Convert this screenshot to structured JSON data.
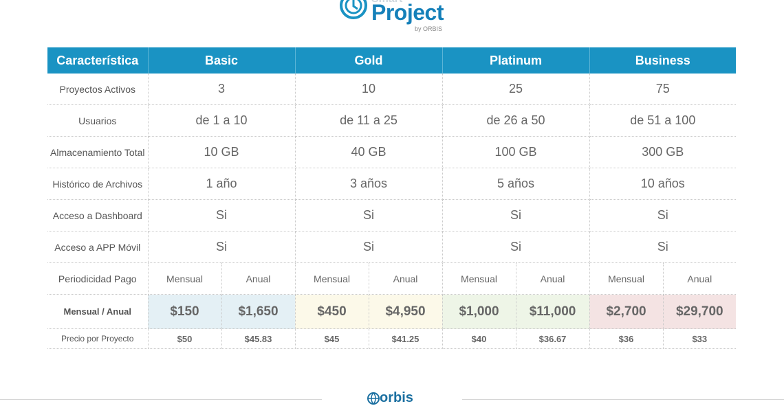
{
  "brand": {
    "line1": "Smart",
    "line2": "Project",
    "byline": "by ORBIS",
    "footer": "orbis",
    "accent": "#1a93c3"
  },
  "table": {
    "headers": [
      "Característica",
      "Basic",
      "Gold",
      "Platinum",
      "Business"
    ],
    "rows": [
      {
        "feature": "Proyectos Activos",
        "values": [
          "3",
          "10",
          "25",
          "75"
        ]
      },
      {
        "feature": "Usuarios",
        "values": [
          "de 1 a 10",
          "de 11 a 25",
          "de 26 a 50",
          "de 51 a 100"
        ]
      },
      {
        "feature": "Almacenamiento Total",
        "values": [
          "10 GB",
          "40 GB",
          "100 GB",
          "300 GB"
        ]
      },
      {
        "feature": "Histórico de Archivos",
        "values": [
          "1 año",
          "3 años",
          "5 años",
          "10 años"
        ]
      },
      {
        "feature": "Acceso a Dashboard",
        "values": [
          "Si",
          "Si",
          "Si",
          "Si"
        ]
      },
      {
        "feature": "Acceso a APP Móvil",
        "values": [
          "Si",
          "Si",
          "Si",
          "Si"
        ]
      }
    ],
    "periodicity": {
      "feature": "Periodicidad Pago",
      "monthly": "Mensual",
      "annual": "Anual"
    },
    "prices": {
      "feature": "Mensual / Anual",
      "values": [
        "$150",
        "$1,650",
        "$450",
        "$4,950",
        "$1,000",
        "$11,000",
        "$2,700",
        "$29,700"
      ]
    },
    "per_project": {
      "feature": "Precio por Proyecto",
      "values": [
        "$50",
        "$45.83",
        "$45",
        "$41.25",
        "$40",
        "$36.67",
        "$36",
        "$33"
      ]
    }
  }
}
